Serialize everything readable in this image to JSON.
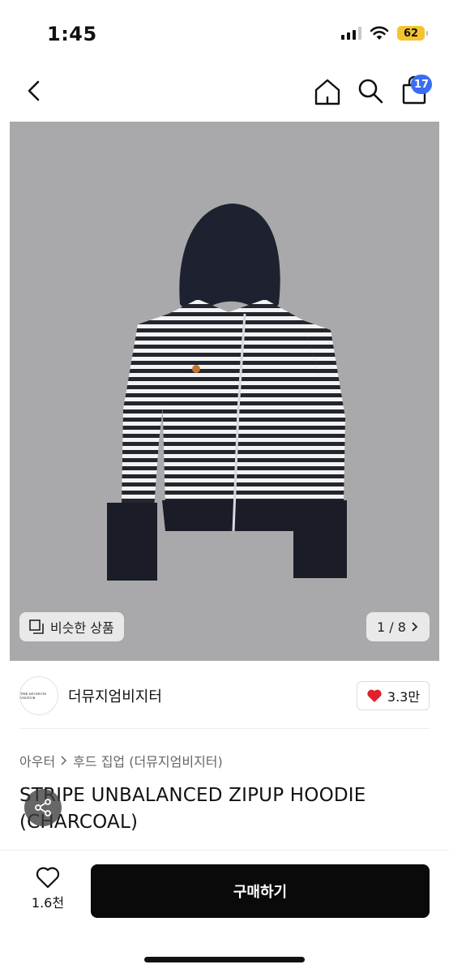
{
  "status_bar": {
    "time": "1:45",
    "battery": "62"
  },
  "nav": {
    "cart_count": "17"
  },
  "gallery": {
    "similar_label": "비슷한 상품",
    "page_indicator": "1 / 8"
  },
  "seller": {
    "name": "더뮤지엄비지터",
    "avatar_text": "THE MUSEUM VISITOR",
    "likes": "3.3만"
  },
  "breadcrumb": [
    "아우터",
    "후드 집업 (더뮤지엄비지터)"
  ],
  "product": {
    "title": "STRIPE UNBALANCED ZIPUP HOODIE (CHARCOAL)"
  },
  "bottom_bar": {
    "wish_count": "1.6천",
    "buy_label": "구매하기"
  },
  "colors": {
    "accent_badge": "#3b6cf6",
    "like_heart": "#e0202a",
    "buy_button": "#0a0a0a",
    "gallery_bg": "#a9a9ab"
  }
}
